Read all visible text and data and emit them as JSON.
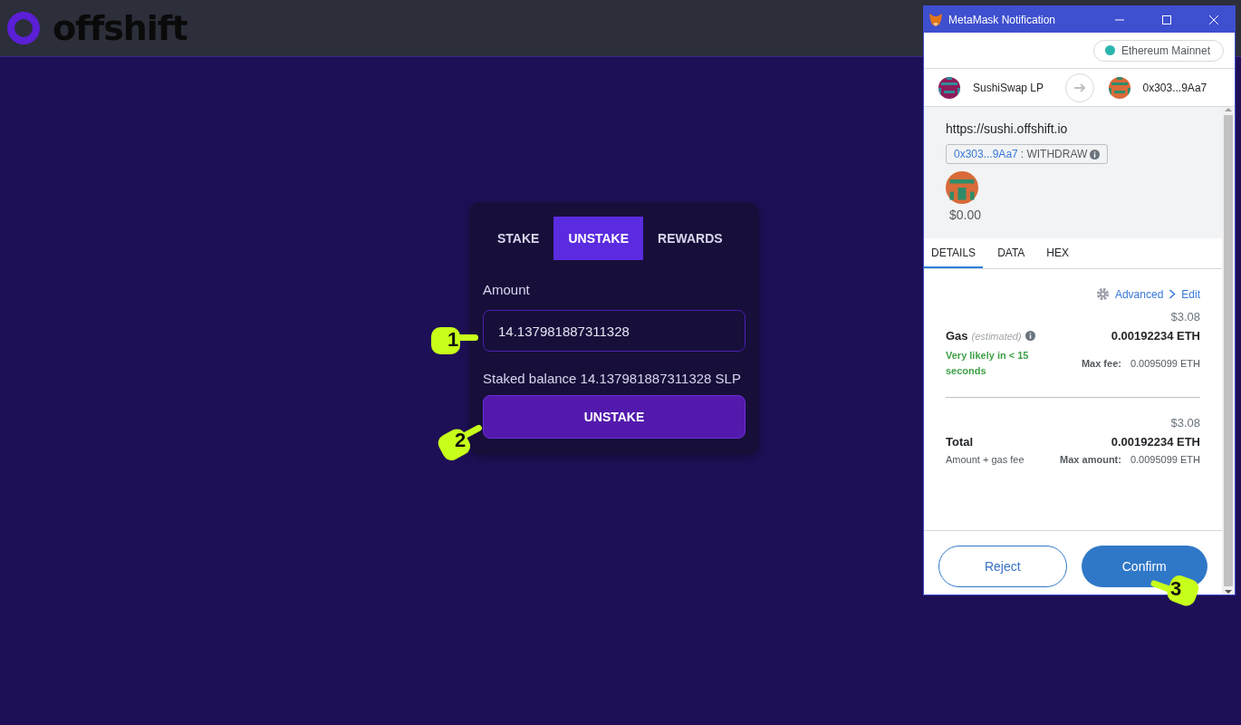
{
  "header": {
    "logo_text": "offshift"
  },
  "stake_card": {
    "tabs": [
      {
        "label": "STAKE",
        "selected": false
      },
      {
        "label": "UNSTAKE",
        "selected": true
      },
      {
        "label": "REWARDS",
        "selected": false
      }
    ],
    "amount_label": "Amount",
    "amount_value": "14.137981887311328",
    "balance_text": "Staked balance 14.137981887311328 SLP",
    "action_button": "UNSTAKE"
  },
  "metamask": {
    "window_title": "MetaMask Notification",
    "network": "Ethereum Mainnet",
    "from": "SushiSwap LP",
    "to": "0x303...9Aa7",
    "origin": "https://sushi.offshift.io",
    "method_address": "0x303...9Aa7",
    "method": ": WITHDRAW",
    "amount": "$0.00",
    "tabs": [
      {
        "label": "DETAILS",
        "selected": true
      },
      {
        "label": "DATA",
        "selected": false
      },
      {
        "label": "HEX",
        "selected": false
      }
    ],
    "advanced": "Advanced",
    "edit": "Edit",
    "gas": {
      "label": "Gas",
      "note": "(estimated)",
      "fiat": "$3.08",
      "eth": "0.00192234 ETH",
      "speed": "Very likely in < 15 seconds",
      "max_label": "Max fee:",
      "max_value": "0.0095099 ETH"
    },
    "total": {
      "label": "Total",
      "fiat": "$3.08",
      "eth": "0.00192234 ETH",
      "sub": "Amount + gas fee",
      "max_label": "Max amount:",
      "max_value": "0.0095099 ETH"
    },
    "reject_button": "Reject",
    "confirm_button": "Confirm"
  },
  "annotations": [
    {
      "number": "1"
    },
    {
      "number": "2"
    },
    {
      "number": "3"
    }
  ]
}
